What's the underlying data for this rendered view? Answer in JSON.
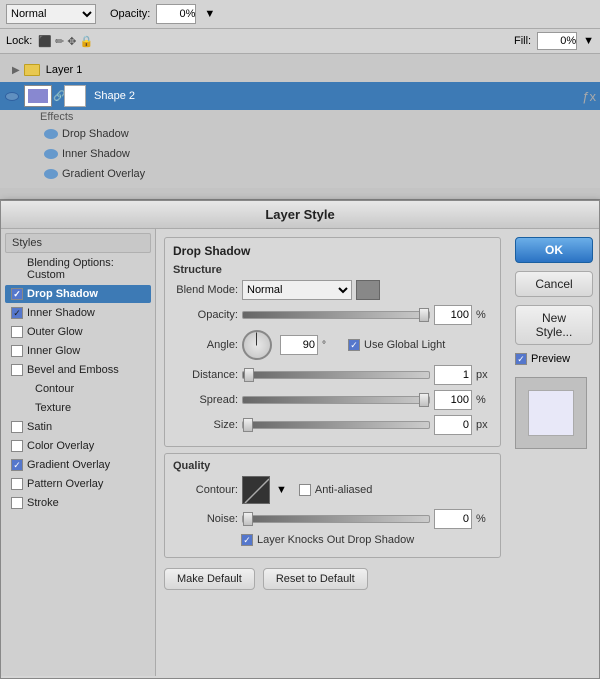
{
  "top": {
    "blend_mode": "Normal",
    "opacity_label": "Opacity:",
    "opacity_value": "0%",
    "lock_label": "Lock:",
    "fill_label": "Fill:",
    "fill_value": "0%"
  },
  "layers": {
    "layer1_name": "Layer 1",
    "shape2_name": "Shape 2",
    "effects_label": "Effects",
    "drop_shadow": "Drop Shadow",
    "inner_shadow": "Inner Shadow",
    "gradient_overlay": "Gradient Overlay"
  },
  "dialog": {
    "title": "Layer Style",
    "ok_label": "OK",
    "cancel_label": "Cancel",
    "new_style_label": "New Style...",
    "preview_label": "Preview"
  },
  "sidebar": {
    "styles_label": "Styles",
    "blending_options": "Blending Options: Custom",
    "drop_shadow": "Drop Shadow",
    "inner_shadow": "Inner Shadow",
    "outer_glow": "Outer Glow",
    "inner_glow": "Inner Glow",
    "bevel_emboss": "Bevel and Emboss",
    "contour": "Contour",
    "texture": "Texture",
    "satin": "Satin",
    "color_overlay": "Color Overlay",
    "gradient_overlay": "Gradient Overlay",
    "pattern_overlay": "Pattern Overlay",
    "stroke": "Stroke"
  },
  "drop_shadow_panel": {
    "section_title": "Drop Shadow",
    "structure_title": "Structure",
    "blend_mode_label": "Blend Mode:",
    "blend_mode_value": "Normal",
    "opacity_label": "Opacity:",
    "opacity_value": "100",
    "opacity_unit": "%",
    "angle_label": "Angle:",
    "angle_value": "90",
    "angle_unit": "°",
    "use_global_light": "Use Global Light",
    "distance_label": "Distance:",
    "distance_value": "1",
    "distance_unit": "px",
    "spread_label": "Spread:",
    "spread_value": "100",
    "spread_unit": "%",
    "size_label": "Size:",
    "size_value": "0",
    "size_unit": "px",
    "quality_title": "Quality",
    "contour_label": "Contour:",
    "anti_aliased": "Anti-aliased",
    "noise_label": "Noise:",
    "noise_value": "0",
    "noise_unit": "%",
    "layer_knocks_out": "Layer Knocks Out Drop Shadow",
    "make_default": "Make Default",
    "reset_to_default": "Reset to Default"
  }
}
